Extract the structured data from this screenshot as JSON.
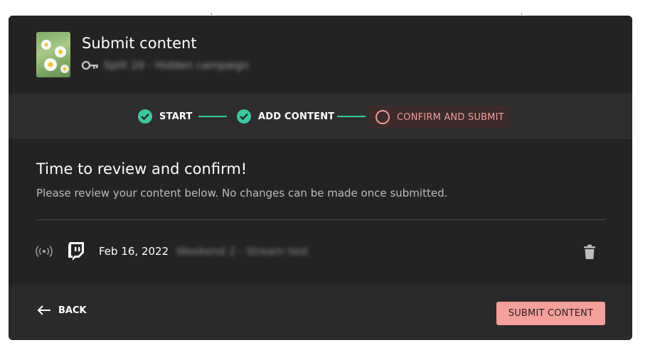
{
  "header": {
    "title": "Submit content",
    "subtitle_blurred": "Split 20 - Hidden campaign"
  },
  "stepper": {
    "steps": [
      {
        "label": "START",
        "state": "complete"
      },
      {
        "label": "ADD CONTENT",
        "state": "complete"
      },
      {
        "label": "CONFIRM AND SUBMIT",
        "state": "active"
      }
    ]
  },
  "review": {
    "title": "Time to review and confirm!",
    "description": "Please review your content below. No changes can be made once submitted."
  },
  "content_row": {
    "date": "Feb 16, 2022",
    "title_blurred": "Weekend 2 - Stream test",
    "platform_icon": "twitch-icon",
    "type_icon": "live-broadcast-icon"
  },
  "footer": {
    "back_label": "BACK",
    "submit_label": "SUBMIT CONTENT"
  },
  "colors": {
    "accent_green": "#3ec79e",
    "accent_salmon": "#f5a19b",
    "modal_bg": "#232323"
  }
}
